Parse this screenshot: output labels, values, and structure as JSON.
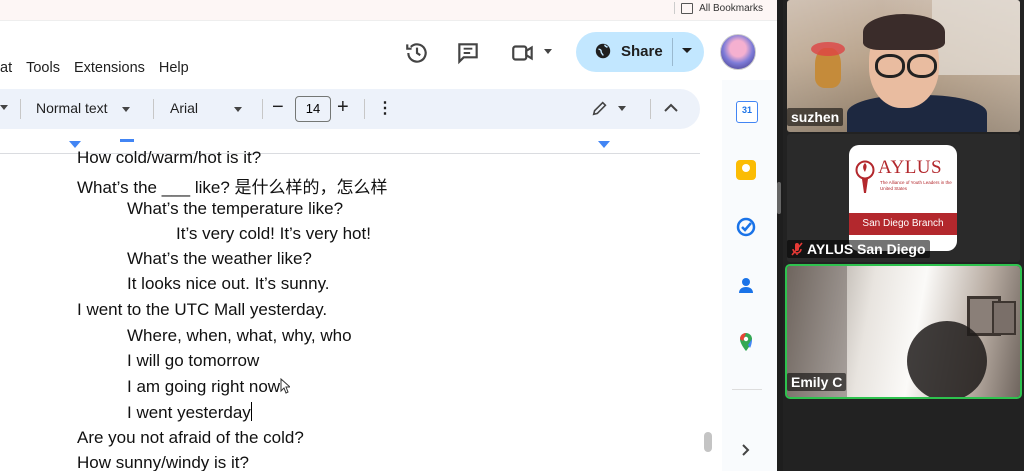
{
  "browser": {
    "bookmarks_label": "All Bookmarks"
  },
  "docs": {
    "menu": [
      "at",
      "Tools",
      "Extensions",
      "Help"
    ],
    "share_label": "Share",
    "toolbar": {
      "style": "Normal text",
      "font": "Arial",
      "font_size": "14"
    }
  },
  "document_lines": [
    "How cold/warm/hot is it?",
    "What’s the ___ like? 是什么样的，怎么样",
    "What’s the temperature like?",
    "It’s very cold! It’s very hot!",
    "What’s the weather like?",
    "It looks nice out. It’s sunny.",
    "I went to the UTC Mall yesterday.",
    "Where, when, what, why, who",
    "I will go tomorrow",
    "I am going right now",
    "I went yesterday",
    "Are you not afraid of the cold?",
    "How sunny/windy is it?"
  ],
  "side_panel": {
    "calendar_day": "31",
    "icons": [
      "calendar-icon",
      "keep-icon",
      "tasks-icon",
      "contacts-icon",
      "maps-icon",
      "expand-icon"
    ]
  },
  "participants": [
    {
      "name": "suzhen"
    },
    {
      "name": "AYLUS San Diego",
      "muted": true,
      "logo": {
        "title": "AYLUS",
        "subtitle": "The Alliance of Youth Leaders in the United States",
        "band": "San Diego Branch"
      }
    },
    {
      "name": "Emily C",
      "active_speaker": true
    }
  ],
  "colors": {
    "share_bg": "#c2e7ff",
    "toolbar_bg": "#edf2fa",
    "active_speaker": "#2ec24e",
    "aylus_red": "#b3282d"
  }
}
